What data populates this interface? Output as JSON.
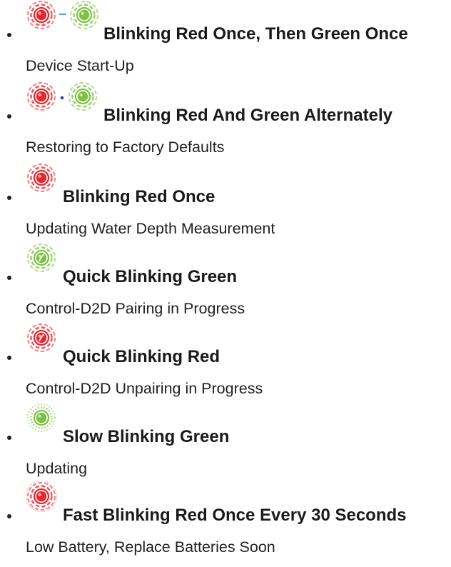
{
  "colors": {
    "red": "#e8262b",
    "green": "#7cc242",
    "connector_dash": "#2e7fc4",
    "connector_dot": "#1f4fa0",
    "text": "#1a1a1a"
  },
  "items": [
    {
      "icons": [
        "red-ring-icon",
        "dash-connector-icon",
        "green-ring-icon"
      ],
      "title": "Blinking Red Once, Then Green Once",
      "description": "Device Start-Up"
    },
    {
      "icons": [
        "red-ring-icon",
        "dot-connector-icon",
        "green-ring-icon"
      ],
      "title": "Blinking Red And Green Alternately",
      "description": "Restoring to Factory Defaults"
    },
    {
      "icons": [
        "red-ring-icon"
      ],
      "title": "Blinking Red Once",
      "description": "Updating Water Depth Measurement"
    },
    {
      "icons": [
        "green-quick-blink-icon"
      ],
      "title": "Quick Blinking Green",
      "description": "Control-D2D Pairing in Progress"
    },
    {
      "icons": [
        "red-quick-blink-icon"
      ],
      "title": "Quick Blinking Red",
      "description": "Control-D2D Unpairing in Progress"
    },
    {
      "icons": [
        "green-slow-blink-icon"
      ],
      "title": "Slow Blinking Green",
      "description": "Updating"
    },
    {
      "icons": [
        "red-fast-blink-icon"
      ],
      "title": "Fast Blinking Red Once Every 30 Seconds",
      "description": "Low Battery, Replace Batteries Soon"
    }
  ]
}
